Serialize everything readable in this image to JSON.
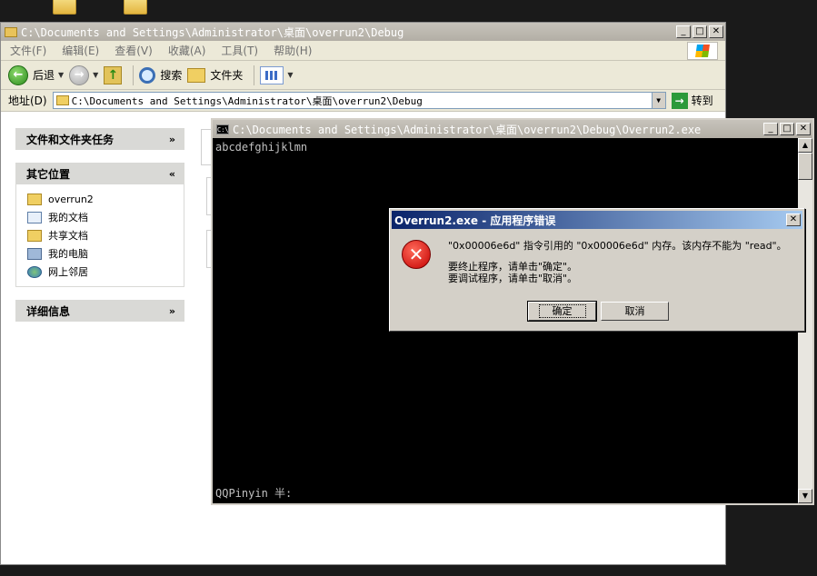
{
  "explorer": {
    "title": "C:\\Documents and Settings\\Administrator\\桌面\\overrun2\\Debug",
    "menu": [
      "文件(F)",
      "编辑(E)",
      "查看(V)",
      "收藏(A)",
      "工具(T)",
      "帮助(H)"
    ],
    "toolbar": {
      "back": "后退",
      "search": "搜索",
      "folders": "文件夹"
    },
    "address_label": "地址(D)",
    "address_value": "C:\\Documents and Settings\\Administrator\\桌面\\overrun2\\Debug",
    "go_label": "转到",
    "tasks_panel": "文件和文件夹任务",
    "other_places_panel": "其它位置",
    "places": [
      "overrun2",
      "我的文档",
      "共享文档",
      "我的电脑",
      "网上邻居"
    ],
    "details_panel": "详细信息"
  },
  "console": {
    "title": "C:\\Documents and Settings\\Administrator\\桌面\\overrun2\\Debug\\Overrun2.exe",
    "output": "abcdefghijklmn",
    "ime_status": "QQPinyin 半:"
  },
  "dialog": {
    "title": "Overrun2.exe - 应用程序错误",
    "message_line1": "\"0x00006e6d\" 指令引用的 \"0x00006e6d\" 内存。该内存不能为 \"read\"。",
    "message_line2": "要终止程序，请单击\"确定\"。",
    "message_line3": "要调试程序，请单击\"取消\"。",
    "ok": "确定",
    "cancel": "取消"
  }
}
